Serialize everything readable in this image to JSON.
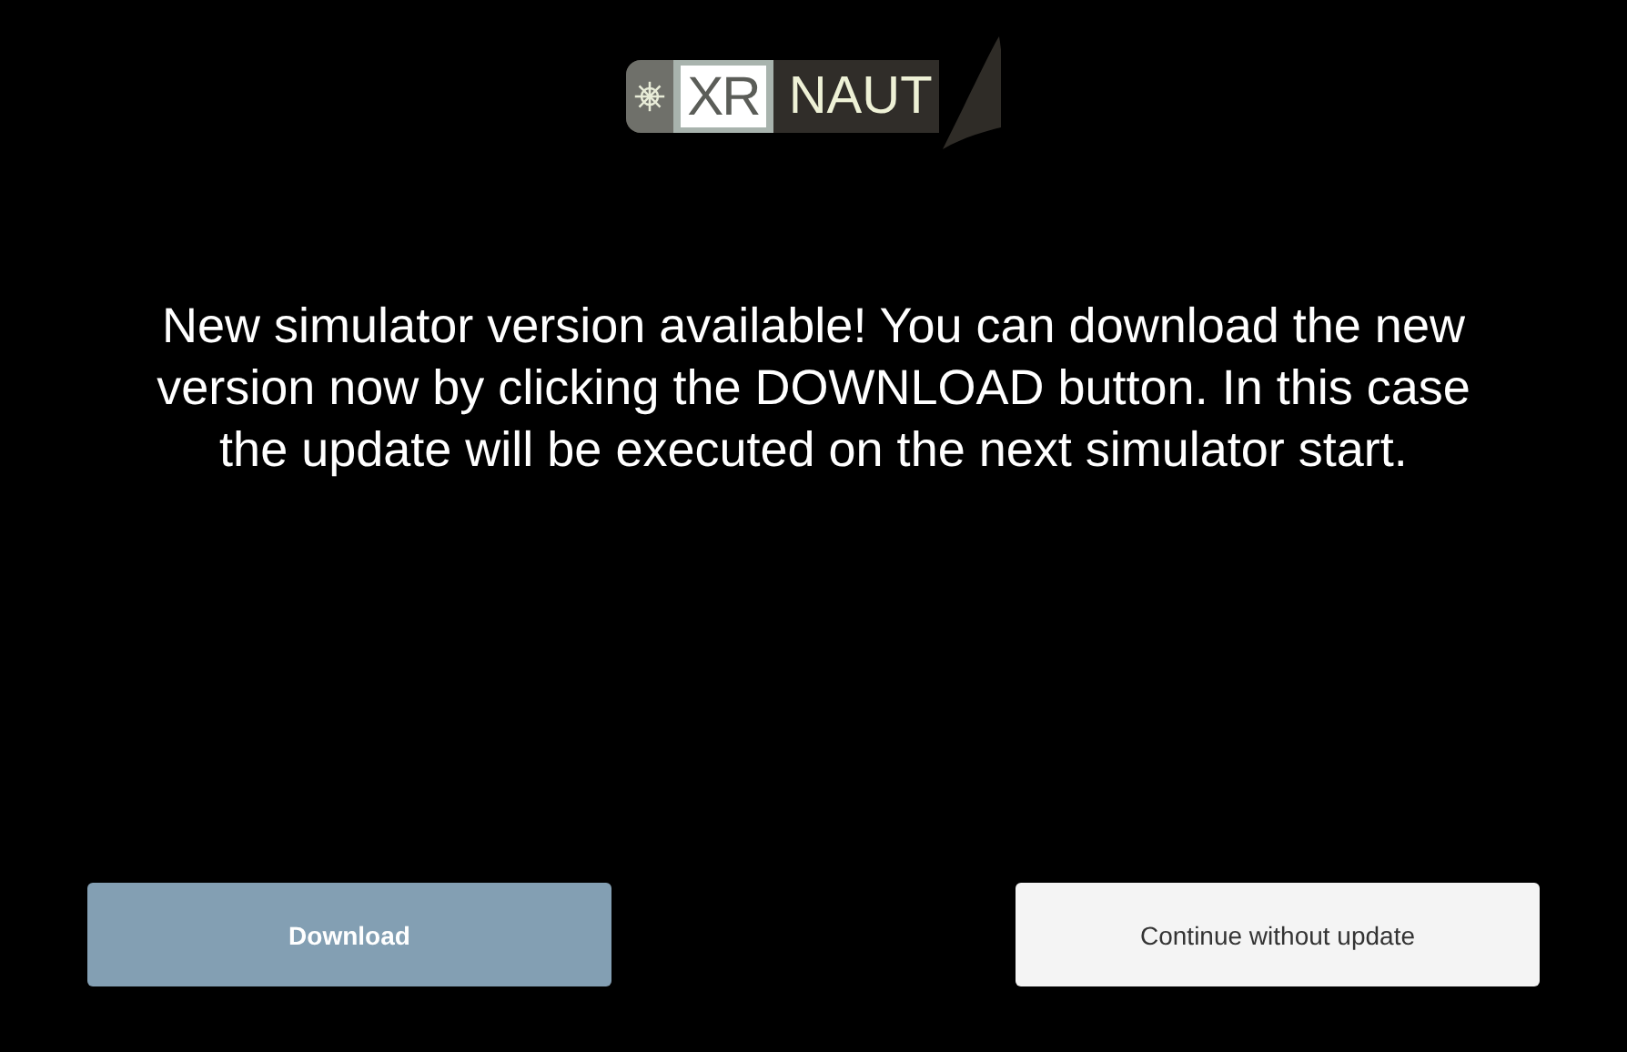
{
  "logo": {
    "prefix": "XR",
    "name": "NAUT"
  },
  "message": "New simulator version available! You can download the new version now by clicking the DOWNLOAD button. In this case the update will be executed on the next simulator start.",
  "buttons": [
    {
      "label": "Download",
      "kind": "primary"
    },
    {
      "label": "Continue without update",
      "kind": "secondary"
    }
  ]
}
